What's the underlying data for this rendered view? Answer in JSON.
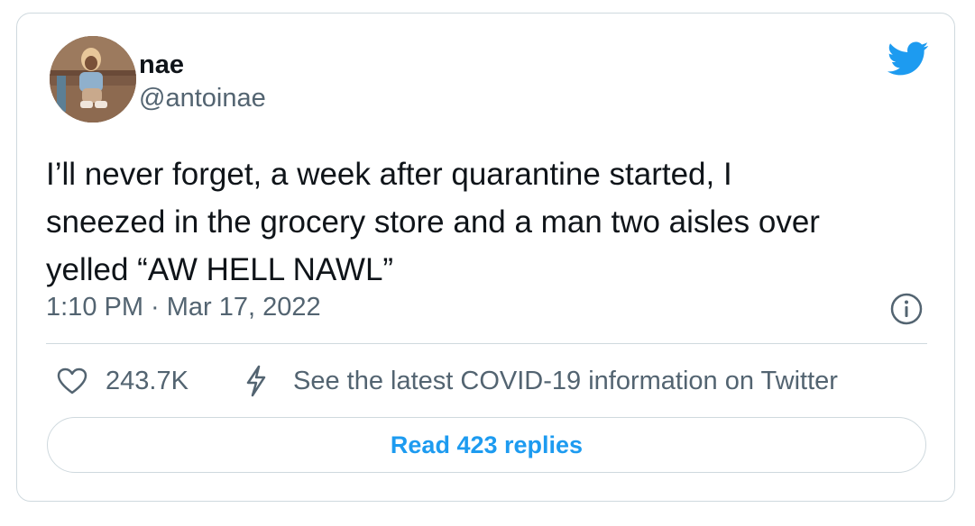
{
  "author": {
    "display_name": "nae",
    "handle": "@antoinae"
  },
  "tweet": {
    "text_lines": [
      "I’ll never forget, a week after quarantine started, I",
      "sneezed in the grocery store and a man two aisles over",
      "yelled “AW HELL NAWL”"
    ],
    "timestamp": "1:10 PM · Mar 17, 2022"
  },
  "actions": {
    "likes": "243.7K",
    "covid_label": "See the latest COVID-19 information on Twitter"
  },
  "replies_button": {
    "label": "Read 423 replies"
  },
  "icons": {
    "brand": "twitter-bird-icon",
    "info": "info-icon",
    "like": "heart-icon",
    "covid": "lightning-bolt-icon"
  },
  "colors": {
    "brand_blue": "#1d9bf0",
    "text_primary": "#0f1419",
    "text_secondary": "#536471",
    "border": "#cfd9de"
  }
}
